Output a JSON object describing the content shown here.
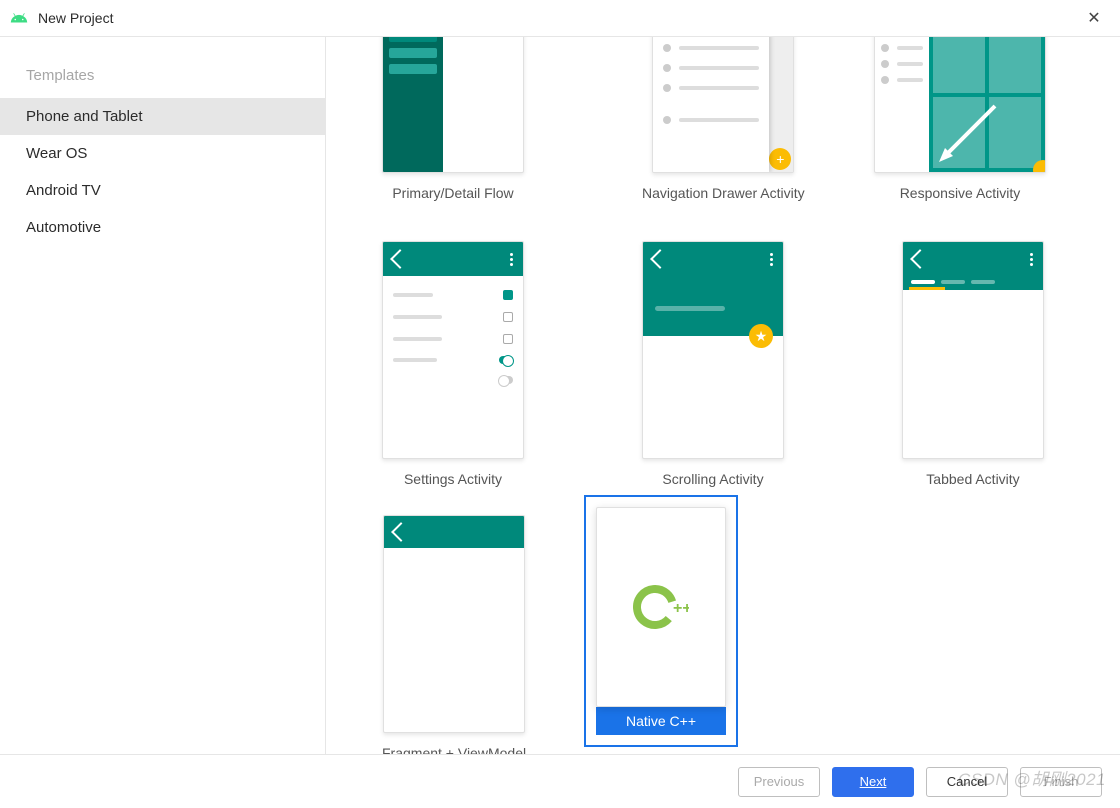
{
  "window": {
    "title": "New Project"
  },
  "sidebar": {
    "heading": "Templates",
    "items": [
      {
        "label": "Phone and Tablet",
        "selected": true
      },
      {
        "label": "Wear OS",
        "selected": false
      },
      {
        "label": "Android TV",
        "selected": false
      },
      {
        "label": "Automotive",
        "selected": false
      }
    ]
  },
  "templates_row0": [
    {
      "label": "Primary/Detail Flow"
    },
    {
      "label": "Navigation Drawer Activity"
    },
    {
      "label": "Responsive Activity"
    }
  ],
  "templates_row1": [
    {
      "label": "Settings Activity"
    },
    {
      "label": "Scrolling Activity"
    },
    {
      "label": "Tabbed Activity"
    }
  ],
  "templates_row2": [
    {
      "label": "Fragment + ViewModel"
    },
    {
      "label": "Native C++",
      "selected": true
    }
  ],
  "buttons": {
    "previous": "Previous",
    "next": "Next",
    "cancel": "Cancel",
    "finish": "Finish"
  },
  "watermark": "CSDN @胡刚2021"
}
